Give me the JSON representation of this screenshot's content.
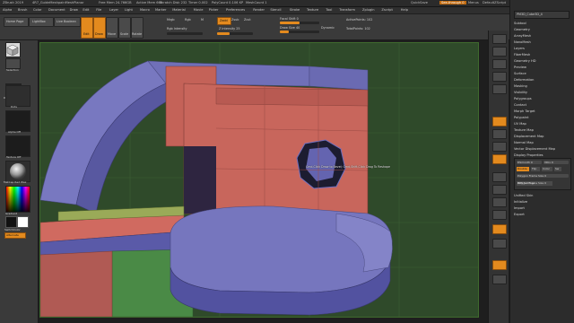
{
  "titlebar": {
    "app": "ZBrush 2019",
    "file": "4R7_GuideMeshpainMeshPlanar",
    "segments": [
      "Free Mem 24.766GB",
      "Active Mem 669",
      "Scratch Disk 232",
      "Timer 0.002",
      "PolyCount 0.106 KP",
      "MeshCount 1"
    ],
    "right": [
      "QuickSave",
      "See-through 0",
      "Menus",
      "DefaultZScript"
    ]
  },
  "menu": [
    "Alpha",
    "Brush",
    "Color",
    "Document",
    "Draw",
    "Edit",
    "File",
    "Layer",
    "Light",
    "Macro",
    "Marker",
    "Material",
    "Movie",
    "Picker",
    "Preferences",
    "Render",
    "Stencil",
    "Stroke",
    "Texture",
    "Tool",
    "Transform",
    "Zplugin",
    "Zscript",
    "Help"
  ],
  "shelf": {
    "buttons": [
      "Home Page",
      "LightBox",
      "Live Boolean"
    ],
    "tools": [
      "Edit",
      "Draw",
      "Move",
      "Scale",
      "Rotate"
    ],
    "mrgb": "Mrgb",
    "rgb": "Rgb",
    "m": "M",
    "zadd": "Zadd",
    "zsub": "Zsub",
    "zcut": "Zcut",
    "rgb_intensity": "Rgb Intensity",
    "z_intensity": "Z Intensity 25",
    "focal_shift": "Focal Shift 0",
    "draw_size": "Draw Size 40",
    "dynamic": "Dynamic",
    "active_points": "ActivePoints: 102",
    "total_points": "TotalPoints: 102"
  },
  "leftshelf": {
    "items": [
      "Selection",
      "Polyhedra",
      "SliceCurve",
      "DynamicEdit",
      "Dots",
      "Alpha Off",
      "Texture Off",
      "MatCap Red Wax"
    ],
    "gradient": "Gradient",
    "switch_color": "SwitchColor",
    "alternate": "Alternate"
  },
  "viewport": {
    "hint": "Cmd-Click Draw to Bevel; Cmd-Shift-Click Drag To Reshape"
  },
  "righttools": [
    "BPR",
    "SPix 3",
    "Scroll",
    "Zoom",
    "Actual",
    "AAHalf",
    "Persp",
    "Floor",
    "Local",
    "L.Sym",
    "Frame",
    "Move",
    "Scale",
    "Rotate",
    "Line Fill",
    "PolyF",
    "Transp",
    "Solo",
    "Xpose"
  ],
  "rightmenu": {
    "header": "PM3D_Cube3D_4",
    "items": [
      "Subtool",
      "Geometry",
      "ArrayMesh",
      "NanoMesh",
      "Layers",
      "FiberMesh",
      "Geometry HD",
      "Preview",
      "Surface",
      "Deformation",
      "Masking",
      "Visibility",
      "Polygroups",
      "Contact",
      "Morph Target",
      "Polypaint",
      "UV Map",
      "Texture Map",
      "Displacement Map",
      "Normal Map",
      "Vector Displacement Map",
      "Display Properties"
    ],
    "dp_smooth": "DSmooth 0",
    "dp_vdiv": "VDiv 0",
    "dp_double": "Double",
    "dp_flip": "Flip",
    "dp_color": "Color",
    "dp_sw": "Sw",
    "dp_polygon_size": "Polygon Frame Size 0",
    "bpr_settings": "BPR Settings",
    "more": [
      "Unified Skin",
      "Initialize",
      "Import",
      "Export"
    ]
  },
  "colors": {
    "accent": "#e38a1e",
    "panel": "#3a3a3a",
    "viewport_bg": "#2f4a2a",
    "blue_face": "#6f6fb8",
    "red_face": "#c2605a",
    "green_face": "#5a8a44"
  }
}
